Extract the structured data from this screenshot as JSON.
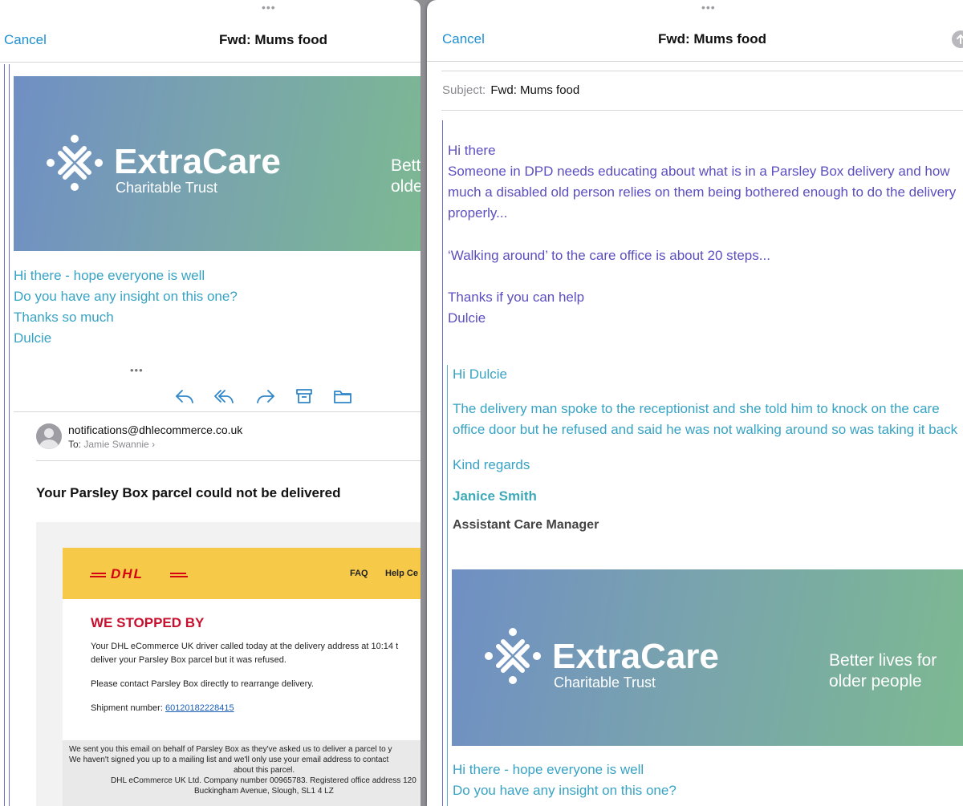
{
  "left": {
    "navbar": {
      "cancel": "Cancel",
      "title": "Fwd: Mums food"
    },
    "banner": {
      "brand": "ExtraCare",
      "sub": "Charitable Trust",
      "tag1": "Bett",
      "tag2": "olde"
    },
    "body": [
      "Hi there - hope everyone is well",
      "Do you have any insight on this one?",
      "Thanks so much",
      "Dulcie"
    ],
    "more": "•••",
    "actions": [
      "reply-icon",
      "reply-all-icon",
      "forward-icon",
      "archive-icon",
      "folder-icon"
    ],
    "sender": {
      "email": "notifications@dhlecommerce.co.uk",
      "to_label": "To:",
      "to_name": "Jamie Swannie",
      "chevron": "›"
    },
    "heading": "Your Parsley Box parcel could not be delivered",
    "dhl": {
      "logo": "DHL",
      "nav": [
        "FAQ",
        "Help Ce"
      ],
      "title": "WE STOPPED BY",
      "p1a": "Your DHL eCommerce UK driver called today at the delivery address at 10:14 t",
      "p1b": "deliver your Parsley Box parcel but it was refused.",
      "p2": "Please contact Parsley Box directly to rearrange delivery.",
      "shipment_label": "Shipment number:",
      "shipment_number": "60120182228415",
      "footer": [
        "We sent you this email on behalf of Parsley Box as they've asked us to deliver a parcel to y",
        "We haven't signed you up to a mailing list and we'll only use your email address to contact",
        "about this parcel.",
        "DHL eCommerce UK Ltd. Company number 00965783. Registered office address 120",
        "Buckingham Avenue, Slough, SL1 4 LZ"
      ]
    }
  },
  "right": {
    "navbar": {
      "cancel": "Cancel",
      "title": "Fwd: Mums food"
    },
    "subject": {
      "label": "Subject:",
      "value": "Fwd: Mums food"
    },
    "body": [
      "Hi there",
      "Someone in DPD needs educating about what is in a Parsley Box delivery and how",
      "much a disabled old person relies on them being bothered enough to do the delivery",
      "properly...",
      "‘Walking around’ to the care office is about 20 steps...",
      "Thanks if you can help",
      "Dulcie"
    ],
    "quote": {
      "greeting": "Hi Dulcie",
      "line1": "The delivery man spoke to the receptionist  and she told him to knock on the care",
      "line2": "office door but he refused and said he was not walking around so was taking it back",
      "regards": "Kind regards",
      "name": "Janice Smith",
      "role": "Assistant Care Manager"
    },
    "banner": {
      "brand": "ExtraCare",
      "sub": "Charitable Trust",
      "tag1": "Better lives for",
      "tag2": "older people"
    },
    "trailing": [
      "Hi there - hope everyone is well",
      "Do you have any insight on this one?"
    ]
  },
  "colors": {
    "accent": "#1f8fd1",
    "teal_text": "#37a3c4",
    "purple_text": "#5b4fc0",
    "dhl_yellow": "#f6c948",
    "dhl_red": "#d40511"
  }
}
